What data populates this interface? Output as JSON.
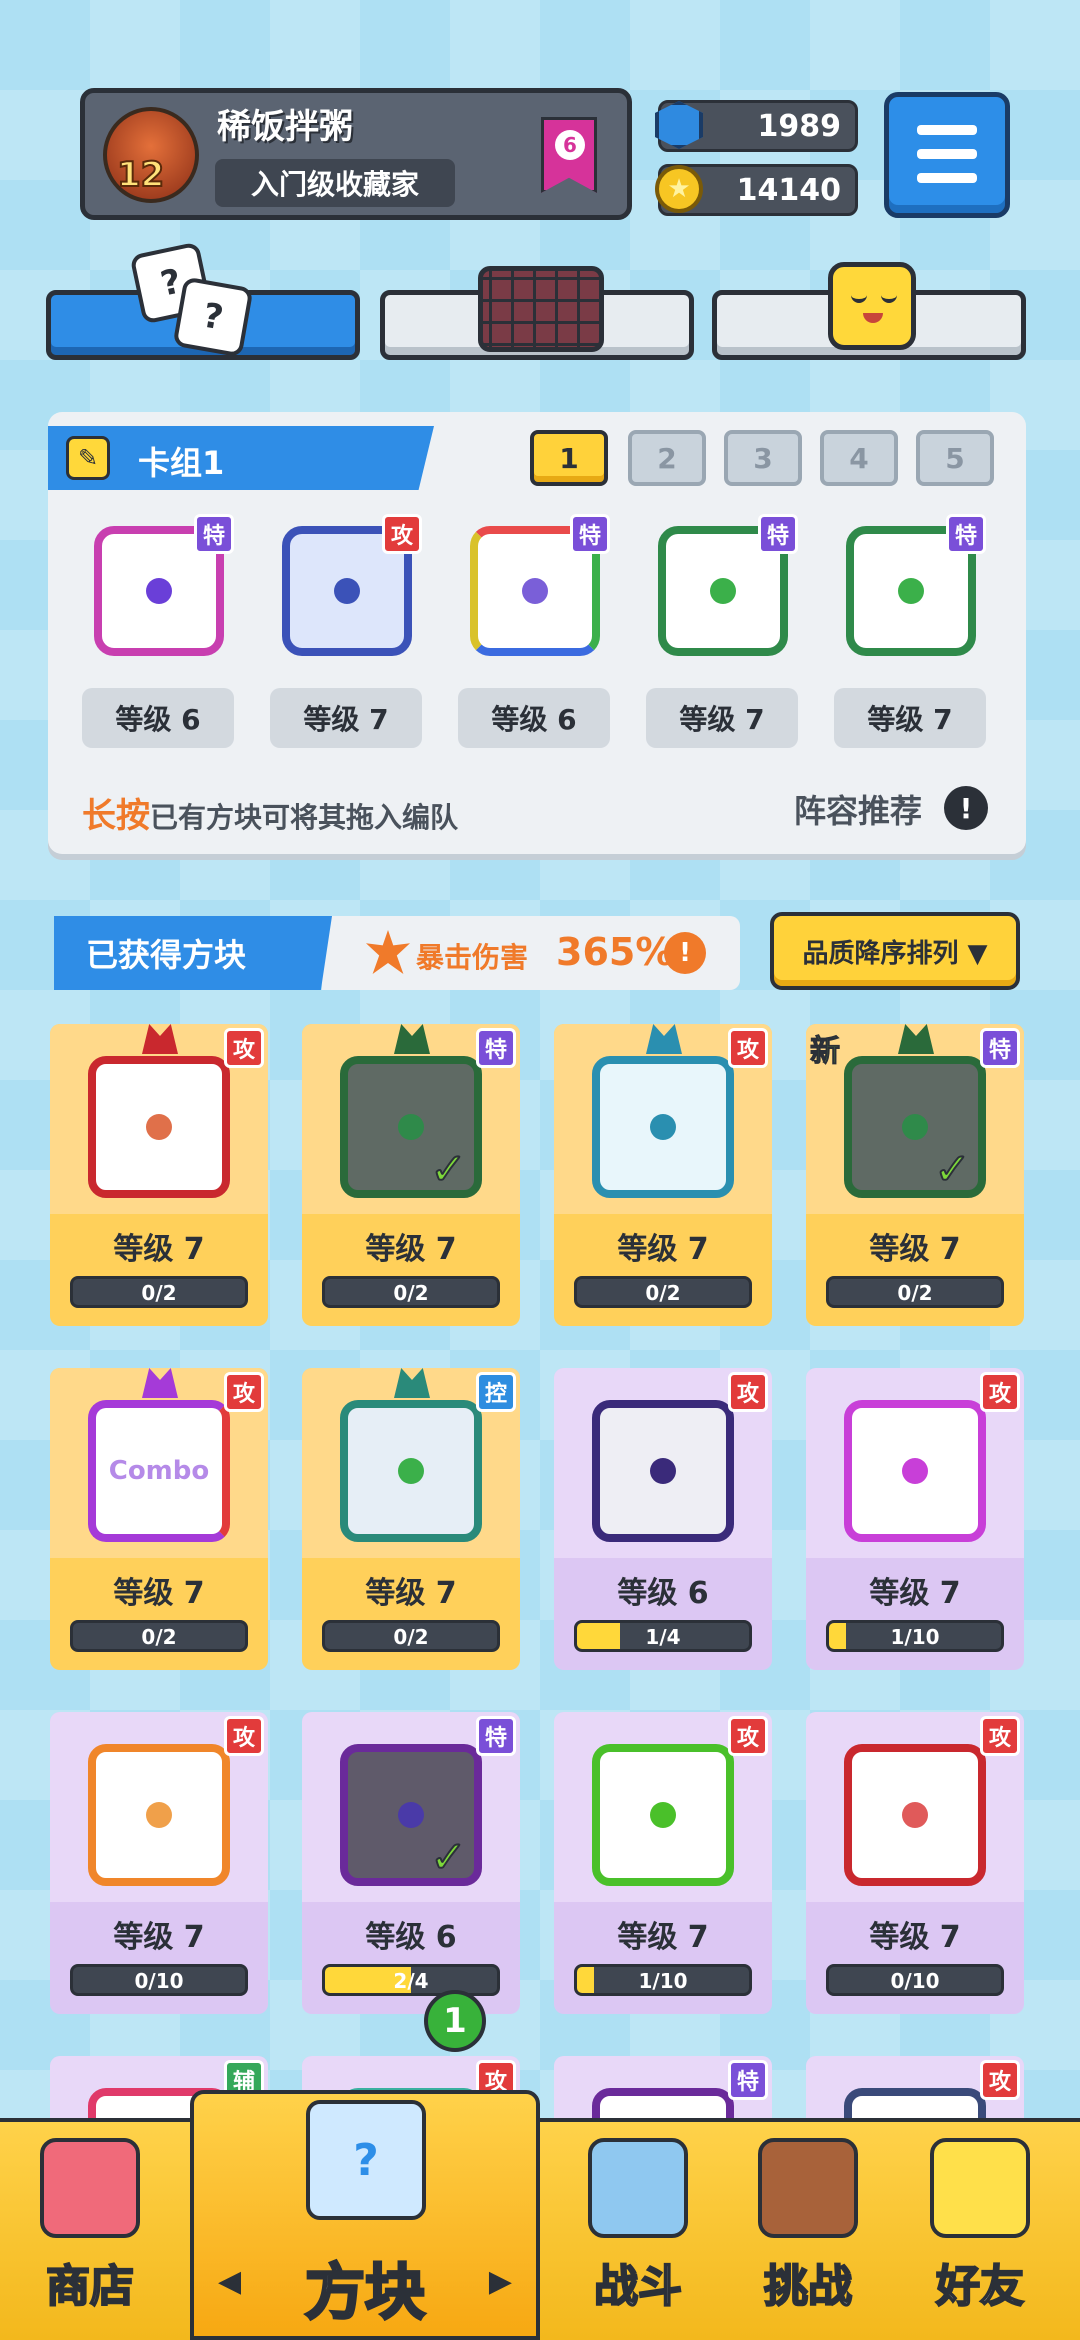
{
  "profile": {
    "name": "稀饭拌粥",
    "title": "入门级收藏家",
    "level": "12",
    "rank": "6"
  },
  "currency": {
    "gems": "1989",
    "coins": "14140"
  },
  "deck": {
    "title": "卡组1",
    "slots": [
      "1",
      "2",
      "3",
      "4",
      "5"
    ],
    "active_slot": "1",
    "cards": [
      {
        "badge": "特",
        "level": "等级 6"
      },
      {
        "badge": "攻",
        "level": "等级 7"
      },
      {
        "badge": "特",
        "level": "等级 6"
      },
      {
        "badge": "特",
        "level": "等级 7"
      },
      {
        "badge": "特",
        "level": "等级 7"
      }
    ],
    "hint_emph": "长按",
    "hint_rest": "已有方块可将其拖入编队",
    "recommend": "阵容推荐",
    "recommend_icon": "!"
  },
  "owned": {
    "title": "已获得方块",
    "crit_label": "暴击伤害",
    "crit_value": "365%",
    "crit_icon": "!",
    "sort_label": "品质降序排列 ▼",
    "cards": [
      {
        "badge": "攻",
        "level": "等级 7",
        "progress": "0/2",
        "fill": 0
      },
      {
        "badge": "特",
        "level": "等级 7",
        "progress": "0/2",
        "fill": 0
      },
      {
        "badge": "攻",
        "level": "等级 7",
        "progress": "0/2",
        "fill": 0
      },
      {
        "badge": "特",
        "level": "等级 7",
        "progress": "0/2",
        "fill": 0,
        "new_tag": "新"
      },
      {
        "badge": "攻",
        "level": "等级 7",
        "progress": "0/2",
        "fill": 0,
        "face_text": "Combo"
      },
      {
        "badge": "控",
        "level": "等级 7",
        "progress": "0/2",
        "fill": 0
      },
      {
        "badge": "攻",
        "level": "等级 6",
        "progress": "1/4",
        "fill": 0.25
      },
      {
        "badge": "攻",
        "level": "等级 7",
        "progress": "1/10",
        "fill": 0.1
      },
      {
        "badge": "攻",
        "level": "等级 7",
        "progress": "0/10",
        "fill": 0
      },
      {
        "badge": "特",
        "level": "等级 6",
        "progress": "2/4",
        "fill": 0.5
      },
      {
        "badge": "攻",
        "level": "等级 7",
        "progress": "1/10",
        "fill": 0.1
      },
      {
        "badge": "攻",
        "level": "等级 7",
        "progress": "0/10",
        "fill": 0
      },
      {
        "badge": "辅"
      },
      {
        "badge": "攻"
      },
      {
        "badge": "特"
      },
      {
        "badge": "攻"
      }
    ]
  },
  "nav": {
    "shop": "商店",
    "dice": "方块",
    "battle": "战斗",
    "challenge": "挑战",
    "friends": "好友",
    "dice_badge": "1",
    "left_arrow": "◀",
    "right_arrow": "▶"
  },
  "colors": {
    "accent_blue": "#2f8de6",
    "gold": "#ffd23a",
    "attack_badge": "#e23b3b",
    "special_badge": "#7a4fd8",
    "control_badge": "#2e8de0",
    "support_badge": "#35a85a"
  },
  "icons": {
    "menu": "hamburger-icon",
    "gem": "gem-icon",
    "coin": "coin-icon",
    "dice_tab": "dice-icon",
    "board_tab": "board-icon",
    "emote_tab": "smiley-icon"
  }
}
